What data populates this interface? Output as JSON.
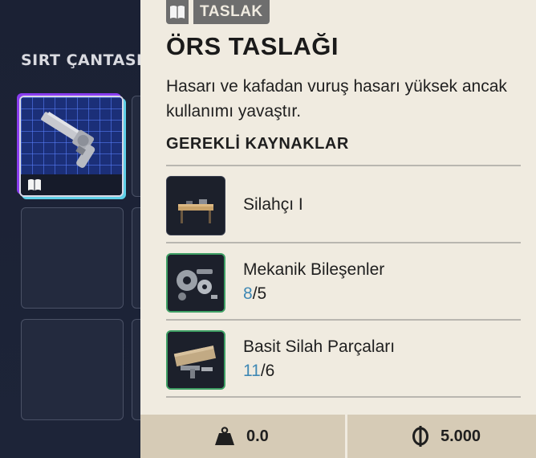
{
  "inventory": {
    "title": "SIRT ÇANTASI"
  },
  "panel": {
    "badge_label": "TASLAK",
    "title": "ÖRS TASLAĞI",
    "description": "Hasarı ve kafadan vuruş hasarı yüksek ancak kullanımı yavaştır.",
    "requirements_title": "GEREKLİ KAYNAKLAR",
    "resources": [
      {
        "name": "Silahçı I",
        "have": "",
        "sep": "",
        "need": "",
        "icon": "workbench-icon"
      },
      {
        "name": "Mekanik Bileşenler",
        "have": "8",
        "sep": "/",
        "need": "5",
        "icon": "mechanical-parts-icon"
      },
      {
        "name": "Basit Silah Parçaları",
        "have": "11",
        "sep": "/",
        "need": "6",
        "icon": "weapon-parts-icon"
      }
    ],
    "footer": {
      "weight": "0.0",
      "value": "5.000"
    }
  },
  "colors": {
    "panel_bg": "#f0ebe0",
    "footer_bg": "#d6cbb6",
    "have_count": "#3f88b4",
    "rarity_border": "#3fa065"
  }
}
